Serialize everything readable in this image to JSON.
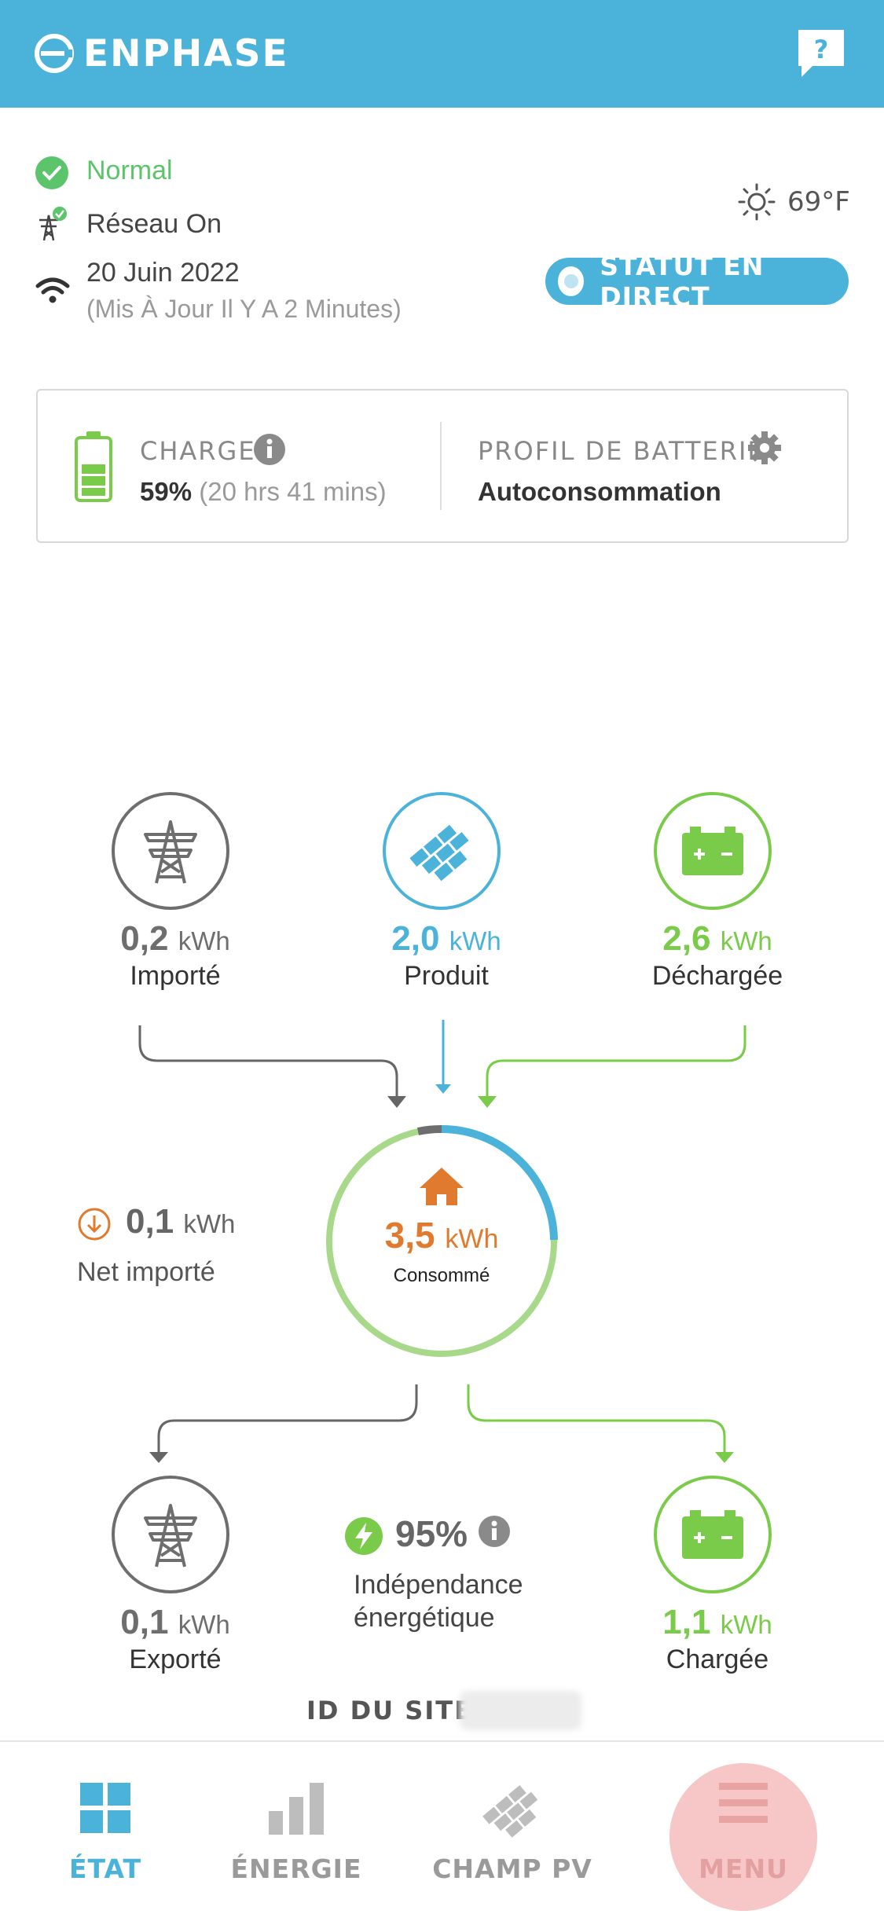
{
  "header": {
    "logo_text": "ENPHASE",
    "help_icon": "question-bubble-icon"
  },
  "status": {
    "system_state": "Normal",
    "grid_state": "Réseau On",
    "date": "20 Juin 2022",
    "updated": "(Mis À Jour Il Y A 2 Minutes)",
    "temperature": "69°F",
    "live_button": "STATUT EN DIRECT"
  },
  "battery_card": {
    "charge_label": "CHARGE",
    "charge_percent": "59%",
    "charge_time": "(20 hrs 41 mins)",
    "profile_label": "PROFIL DE BATTERIE",
    "profile_value": "Autoconsommation"
  },
  "flows": {
    "imported": {
      "value": "0,2",
      "unit": "kWh",
      "label": "Importé"
    },
    "produced": {
      "value": "2,0",
      "unit": "kWh",
      "label": "Produit"
    },
    "discharged": {
      "value": "2,6",
      "unit": "kWh",
      "label": "Déchargée"
    },
    "consumed": {
      "value": "3,5",
      "unit": "kWh",
      "label": "Consommé"
    },
    "net_imported": {
      "value": "0,1",
      "unit": "kWh",
      "label": "Net importé"
    },
    "exported": {
      "value": "0,1",
      "unit": "kWh",
      "label": "Exporté"
    },
    "charged": {
      "value": "1,1",
      "unit": "kWh",
      "label": "Chargée"
    },
    "independence": {
      "value": "95%",
      "label": "Indépendance énergétique"
    }
  },
  "site": {
    "label": "ID DU SITE -"
  },
  "nav": {
    "items": [
      {
        "label": "ÉTAT",
        "icon": "grid-icon",
        "active": true
      },
      {
        "label": "ÉNERGIE",
        "icon": "bar-chart-icon",
        "active": false
      },
      {
        "label": "CHAMP PV",
        "icon": "solar-panel-icon",
        "active": false
      },
      {
        "label": "MENU",
        "icon": "menu-icon",
        "active": false
      }
    ]
  },
  "colors": {
    "brand": "#4BB3D9",
    "green": "#7ACB4A",
    "grey": "#666666",
    "orange": "#E07A2E"
  }
}
